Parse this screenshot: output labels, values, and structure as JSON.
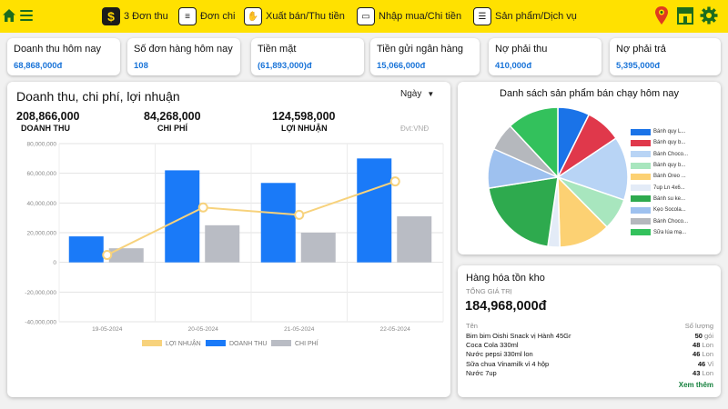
{
  "topbar": {
    "items": [
      {
        "label": "3 Đơn thu",
        "icon": "dollar-icon"
      },
      {
        "label": "Đơn chi",
        "icon": "receipt-icon"
      },
      {
        "label": "Xuất bán/Thu tiền",
        "icon": "hand-cart-icon"
      },
      {
        "label": "Nhập mua/Chi tiền",
        "icon": "cash-icon"
      },
      {
        "label": "Sản phẩm/Dịch vụ",
        "icon": "burger-icon"
      }
    ],
    "colors": {
      "bar": "#ffe100",
      "accent": "#1c6b1e"
    }
  },
  "cards": [
    {
      "label": "Doanh thu hôm nay",
      "value": "68,868,000đ"
    },
    {
      "label": "Số đơn hàng hôm nay",
      "value": "108"
    },
    {
      "label": "Tiền mặt",
      "value": "(61,893,000)đ"
    },
    {
      "label": "Tiền gửi ngân hàng",
      "value": "15,066,000đ"
    },
    {
      "label": "Nợ phải thu",
      "value": "410,000đ"
    },
    {
      "label": "Nợ phải trả",
      "value": "5,395,000đ"
    }
  ],
  "main": {
    "title": "Doanh thu, chi phí, lợi nhuận",
    "period": "Ngày",
    "unit": "Đvt:VNĐ",
    "stats": [
      {
        "value": "208,866,000",
        "label": "DOANH THU"
      },
      {
        "value": "84,268,000",
        "label": "CHI PHÍ"
      },
      {
        "value": "124,598,000",
        "label": "LỢI NHUẬN"
      }
    ]
  },
  "chart_data": [
    {
      "type": "bar",
      "categories": [
        "19-05-2024",
        "20-05-2024",
        "21-05-2024",
        "22-05-2024"
      ],
      "series": [
        {
          "name": "DOANH THU",
          "type": "bar",
          "color": "#1a7af8",
          "values": [
            17500000,
            62000000,
            53500000,
            70000000
          ]
        },
        {
          "name": "CHI PHÍ",
          "type": "bar",
          "color": "#b9bcc4",
          "values": [
            9500000,
            25000000,
            20000000,
            31000000
          ]
        },
        {
          "name": "LỢI NHUẬN",
          "type": "line",
          "color": "#f7d27c",
          "values": [
            5000000,
            37000000,
            32000000,
            54500000
          ]
        }
      ],
      "y_ticks": [
        "80,000,000",
        "60,000,000",
        "40,000,000",
        "20,000,000",
        "0",
        "-20,000,000",
        "-40,000,000"
      ],
      "ylim": [
        -40000000,
        80000000
      ],
      "legend": [
        "LỢI NHUẬN",
        "DOANH THU",
        "CHI PHÍ"
      ],
      "legend_position": "bottom",
      "grid": true
    },
    {
      "type": "pie",
      "title": "Danh sách sản phẩm bán chạy hôm nay",
      "labels": [
        "Bánh quy L...",
        "Bánh quy b...",
        "Bánh Choco...",
        "Bánh quy b...",
        "Bánh Oreo ...",
        "7up Ln 4x6...",
        "Bánh su ke...",
        "Kẹo Socola...",
        "Bánh Choco...",
        "Sữa lúa mạ..."
      ],
      "colors": [
        "#1a73e8",
        "#e0384b",
        "#b8d4f5",
        "#a8e6be",
        "#fcd173",
        "#e3ebf7",
        "#2eaa4e",
        "#9ec1ef",
        "#b5b8bd",
        "#33c15c"
      ],
      "values": [
        8,
        9,
        16,
        8,
        13,
        3,
        22,
        10,
        7,
        13
      ],
      "legend_position": "right"
    }
  ],
  "stock": {
    "title": "Hàng hóa tồn kho",
    "subtitle": "TỔNG GIÁ TRỊ",
    "total": "184,968,000đ",
    "col_name": "Tên",
    "col_qty": "Số lượng",
    "rows": [
      {
        "name": "Bim bim Oishi Snack vị Hành 45Gr",
        "qty": "50",
        "unit": "gói"
      },
      {
        "name": "Coca Cola 330ml",
        "qty": "48",
        "unit": "Lon"
      },
      {
        "name": "Nước pepsi 330ml lon",
        "qty": "46",
        "unit": "Lon"
      },
      {
        "name": "Sữa chua Vinamilk vỉ 4 hộp",
        "qty": "46",
        "unit": "Vỉ"
      },
      {
        "name": "Nước 7up",
        "qty": "43",
        "unit": "Lon"
      }
    ],
    "more": "Xem thêm"
  }
}
